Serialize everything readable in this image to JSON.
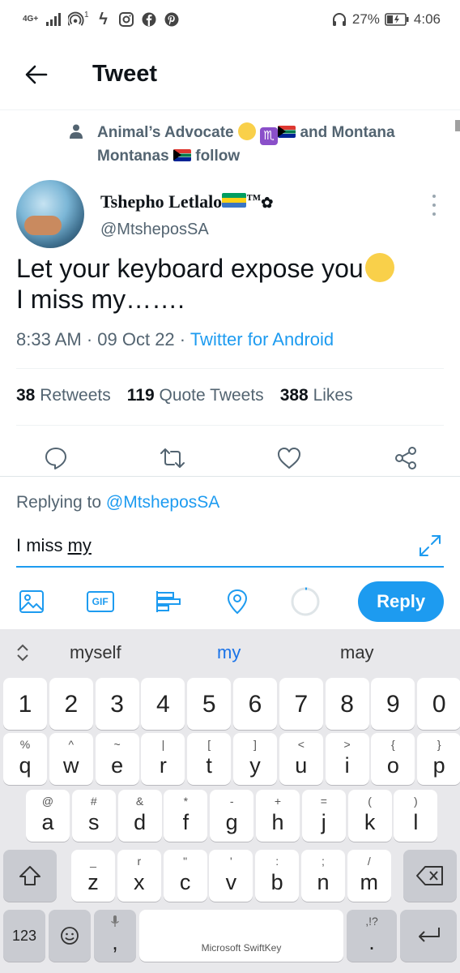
{
  "status_bar": {
    "network_label": "4G+",
    "hotspot_badge": "1",
    "battery": "27%",
    "time": "4:06"
  },
  "header": {
    "title": "Tweet"
  },
  "social_context": {
    "text_part1": "Animal’s Advocate",
    "text_part2": "and Montana Montanas",
    "text_part3": "follow"
  },
  "tweet": {
    "author_name": "Tshepho Letlalo",
    "author_tm": "™",
    "handle": "@MtsheposSA",
    "text_line1": "Let your keyboard expose you",
    "text_line2": "I miss my…….",
    "time": "8:33 AM",
    "date": "09 Oct 22",
    "source": "Twitter for Android",
    "meta_sep": " · "
  },
  "stats": {
    "retweets_count": "38",
    "retweets_label": "Retweets",
    "quotes_count": "119",
    "quotes_label": "Quote Tweets",
    "likes_count": "388",
    "likes_label": "Likes"
  },
  "reply": {
    "replying_prefix": "Replying to",
    "replying_handle": "@MtsheposSA",
    "draft_prefix": "I miss ",
    "draft_word": "my",
    "reply_button": "Reply",
    "gif_label": "GIF"
  },
  "keyboard": {
    "suggestions": [
      "myself",
      "my",
      "may"
    ],
    "numbers": [
      "1",
      "2",
      "3",
      "4",
      "5",
      "6",
      "7",
      "8",
      "9",
      "0"
    ],
    "row1": [
      {
        "main": "q",
        "sub": "%"
      },
      {
        "main": "w",
        "sub": "^"
      },
      {
        "main": "e",
        "sub": "~"
      },
      {
        "main": "r",
        "sub": "|"
      },
      {
        "main": "t",
        "sub": "["
      },
      {
        "main": "y",
        "sub": "]"
      },
      {
        "main": "u",
        "sub": "<"
      },
      {
        "main": "i",
        "sub": ">"
      },
      {
        "main": "o",
        "sub": "{"
      },
      {
        "main": "p",
        "sub": "}"
      }
    ],
    "row2": [
      {
        "main": "a",
        "sub": "@"
      },
      {
        "main": "s",
        "sub": "#"
      },
      {
        "main": "d",
        "sub": "&"
      },
      {
        "main": "f",
        "sub": "*"
      },
      {
        "main": "g",
        "sub": "-"
      },
      {
        "main": "h",
        "sub": "+"
      },
      {
        "main": "j",
        "sub": "="
      },
      {
        "main": "k",
        "sub": "("
      },
      {
        "main": "l",
        "sub": ")"
      }
    ],
    "row3": [
      {
        "main": "z",
        "sub": "_"
      },
      {
        "main": "x",
        "sub": "r"
      },
      {
        "main": "c",
        "sub": "\""
      },
      {
        "main": "v",
        "sub": "'"
      },
      {
        "main": "b",
        "sub": ":"
      },
      {
        "main": "n",
        "sub": ";"
      },
      {
        "main": "m",
        "sub": "/"
      }
    ],
    "key_123": "123",
    "comma": ",",
    "period": ".",
    "period_sub": ",!?",
    "space_brand": "Microsoft SwiftKey"
  }
}
